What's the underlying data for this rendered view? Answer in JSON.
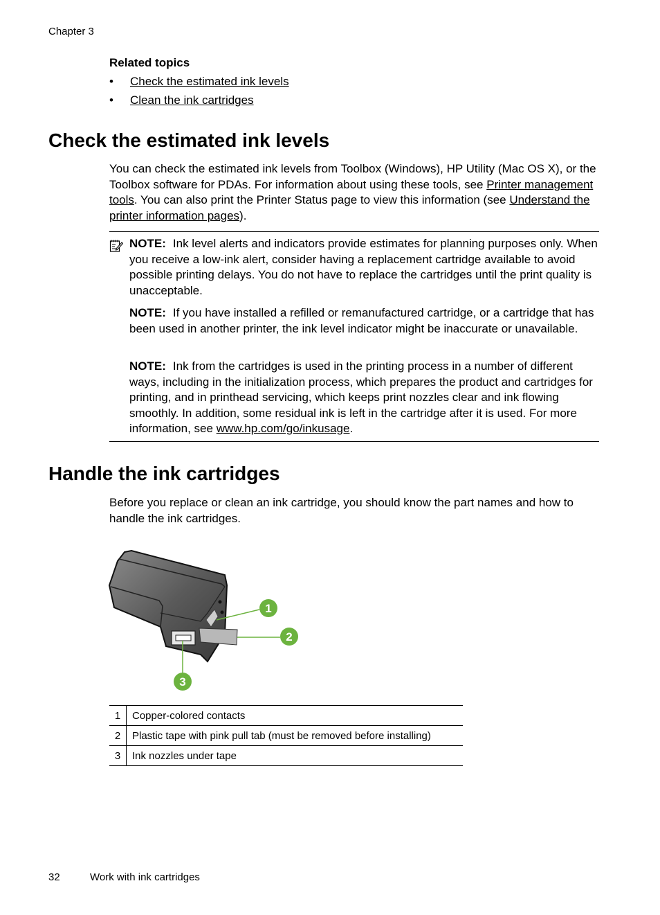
{
  "header": {
    "chapter": "Chapter 3"
  },
  "related": {
    "title": "Related topics",
    "bullet": "•",
    "items": [
      {
        "label": "Check the estimated ink levels"
      },
      {
        "label": "Clean the ink cartridges"
      }
    ]
  },
  "section1": {
    "heading": "Check the estimated ink levels",
    "para": {
      "t1": "You can check the estimated ink levels from Toolbox (Windows), HP Utility (Mac OS X), or the Toolbox software for PDAs. For information about using these tools, see ",
      "link1": "Printer management tools",
      "t2": ". You can also print the Printer Status page to view this information (see ",
      "link2": "Understand the printer information pages",
      "t3": ")."
    },
    "notes": {
      "label": "NOTE:",
      "note1": "Ink level alerts and indicators provide estimates for planning purposes only. When you receive a low-ink alert, consider having a replacement cartridge available to avoid possible printing delays. You do not have to replace the cartridges until the print quality is unacceptable.",
      "note2": "If you have installed a refilled or remanufactured cartridge, or a cartridge that has been used in another printer, the ink level indicator might be inaccurate or unavailable.",
      "note3_text": "Ink from the cartridges is used in the printing process in a number of different ways, including in the initialization process, which prepares the product and cartridges for printing, and in printhead servicing, which keeps print nozzles clear and ink flowing smoothly. In addition, some residual ink is left in the cartridge after it is used. For more information, see ",
      "note3_link": "www.hp.com/go/inkusage",
      "note3_end": "."
    }
  },
  "section2": {
    "heading": "Handle the ink cartridges",
    "para": "Before you replace or clean an ink cartridge, you should know the part names and how to handle the ink cartridges.",
    "figure": {
      "callout_color": "#6cb33f",
      "callouts": [
        "1",
        "2",
        "3"
      ]
    },
    "legend": [
      {
        "num": "1",
        "desc": "Copper-colored contacts"
      },
      {
        "num": "2",
        "desc": "Plastic tape with pink pull tab (must be removed before installing)"
      },
      {
        "num": "3",
        "desc": "Ink nozzles under tape"
      }
    ]
  },
  "footer": {
    "page_number": "32",
    "title": "Work with ink cartridges"
  }
}
